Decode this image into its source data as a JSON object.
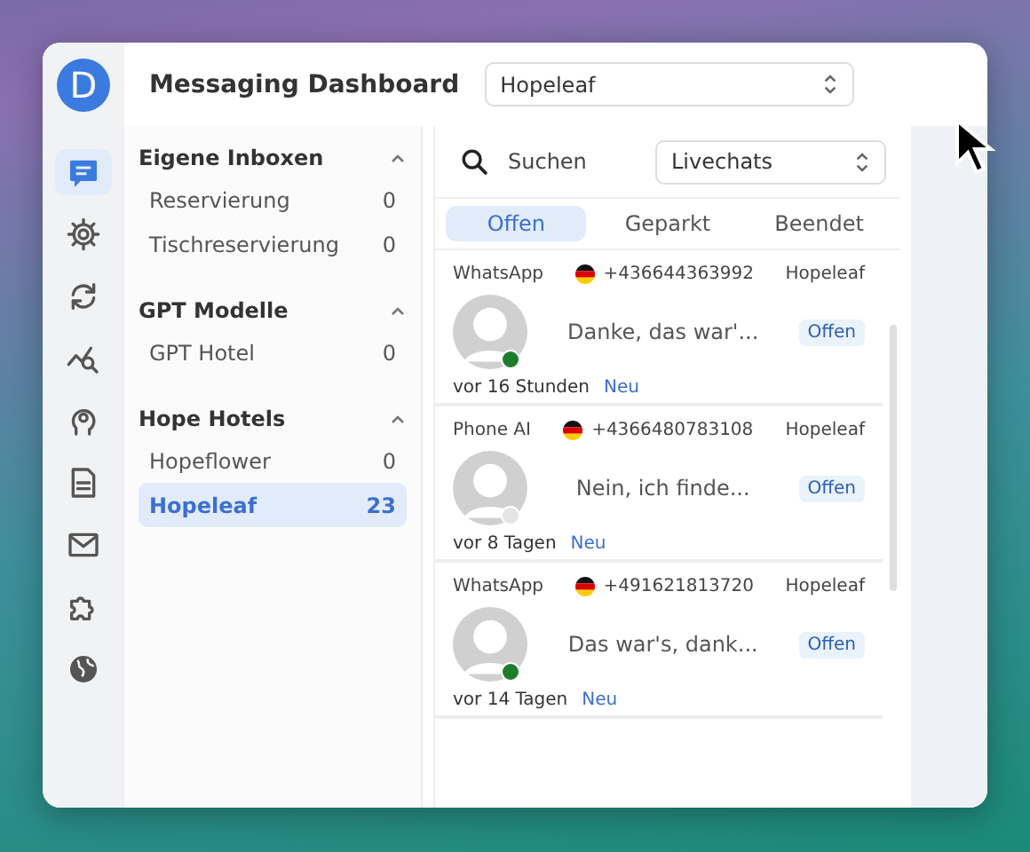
{
  "app": {
    "avatar": "D",
    "title": "Messaging Dashboard"
  },
  "rail": [
    {
      "kind": "chat",
      "selected": true
    },
    {
      "kind": "gear",
      "selected": false
    },
    {
      "kind": "sync",
      "selected": false
    },
    {
      "kind": "chart",
      "selected": false
    },
    {
      "kind": "head",
      "selected": false
    },
    {
      "kind": "doc",
      "selected": false
    },
    {
      "kind": "mail",
      "selected": false
    },
    {
      "kind": "puzzle",
      "selected": false
    },
    {
      "kind": "globe",
      "selected": false
    }
  ],
  "inbox_select": {
    "value": "Hopeleaf"
  },
  "sidebar": {
    "groups": [
      {
        "title": "Eigene Inboxen",
        "expanded": true,
        "items": [
          {
            "label": "Reservierung",
            "count": "0",
            "selected": false
          },
          {
            "label": "Tischreservierung",
            "count": "0",
            "selected": false
          }
        ]
      },
      {
        "title": "GPT Modelle",
        "expanded": true,
        "items": [
          {
            "label": "GPT Hotel",
            "count": "0",
            "selected": false
          }
        ]
      },
      {
        "title": "Hope Hotels",
        "expanded": true,
        "items": [
          {
            "label": "Hopeflower",
            "count": "0",
            "selected": false
          },
          {
            "label": "Hopeleaf",
            "count": "23",
            "selected": true
          }
        ]
      }
    ]
  },
  "search": {
    "placeholder": "Suchen"
  },
  "channel_select": {
    "value": "Livechats"
  },
  "tabs": [
    {
      "label": "Offen",
      "selected": true
    },
    {
      "label": "Geparkt",
      "selected": false
    },
    {
      "label": "Beendet",
      "selected": false
    }
  ],
  "chats": [
    {
      "channel": "WhatsApp",
      "phone": "+436644363992",
      "inbox": "Hopeleaf",
      "preview": "Danke, das war'...",
      "status": "Offen",
      "time": "vor 16 Stunden",
      "tag": "Neu",
      "online": true
    },
    {
      "channel": "Phone AI",
      "phone": "+4366480783108",
      "inbox": "Hopeleaf",
      "preview": "Nein, ich finde...",
      "status": "Offen",
      "time": "vor 8 Tagen",
      "tag": "Neu",
      "online": false
    },
    {
      "channel": "WhatsApp",
      "phone": "+491621813720",
      "inbox": "Hopeleaf",
      "preview": "Das war's, dank...",
      "status": "Offen",
      "time": "vor 14 Tagen",
      "tag": "Neu",
      "online": true
    }
  ]
}
